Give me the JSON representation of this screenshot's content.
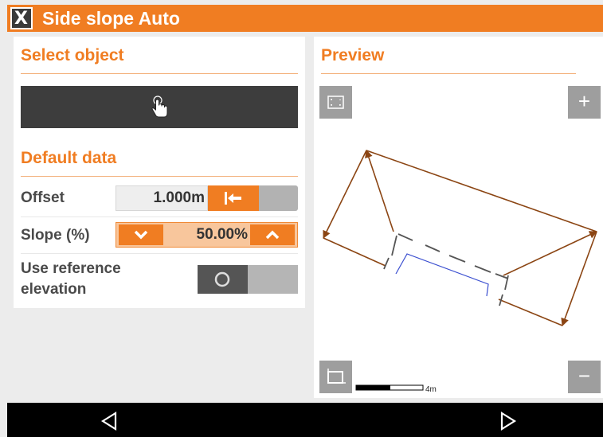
{
  "app": {
    "title": "Side slope Auto",
    "logo_glyph": "X",
    "accent_color": "#f07d22"
  },
  "select_object": {
    "heading": "Select object",
    "button_icon": "tap-hand-icon"
  },
  "default_data": {
    "heading": "Default data",
    "offset": {
      "label": "Offset",
      "value": "1.000m",
      "button_icon": "arrow-to-left-bar-icon"
    },
    "slope": {
      "label": "Slope (%)",
      "value": "50.00%",
      "decrease_icon": "chevron-down-icon",
      "increase_icon": "chevron-up-icon"
    },
    "reference_elevation": {
      "label_line1": "Use reference",
      "label_line2": "elevation",
      "toggle_state": "off"
    }
  },
  "preview": {
    "heading": "Preview",
    "zoom_extents_icon": "zoom-extents-icon",
    "zoom_in_label": "+",
    "zoom_out_label": "−",
    "crop_icon": "crop-icon",
    "scale_label": "4m",
    "line_color": "#8b4513",
    "ref_line_color": "#3b4fd0"
  },
  "navbar": {
    "back_icon": "triangle-left-icon",
    "forward_icon": "triangle-right-icon"
  }
}
